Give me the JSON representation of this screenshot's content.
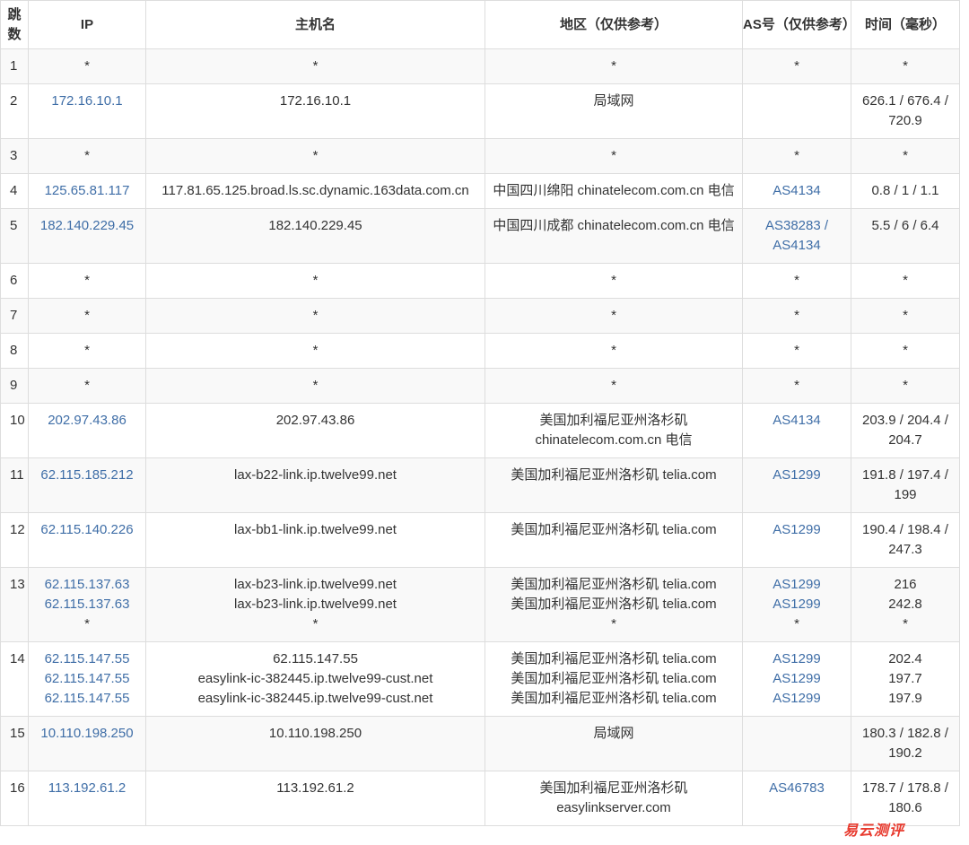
{
  "headers": {
    "hop": "跳数",
    "ip": "IP",
    "host": "主机名",
    "region": "地区（仅供参考）",
    "asn": "AS号（仅供参考）",
    "time": "时间（毫秒）"
  },
  "rows": [
    {
      "hop": "1",
      "ip": [
        "*"
      ],
      "host": [
        "*"
      ],
      "region": [
        "*"
      ],
      "asn": [
        "*"
      ],
      "time": [
        "*"
      ]
    },
    {
      "hop": "2",
      "ip": [
        "172.16.10.1"
      ],
      "host": [
        "172.16.10.1"
      ],
      "region": [
        "局域网"
      ],
      "asn": [],
      "time": [
        "626.1 / 676.4 / 720.9"
      ]
    },
    {
      "hop": "3",
      "ip": [
        "*"
      ],
      "host": [
        "*"
      ],
      "region": [
        "*"
      ],
      "asn": [
        "*"
      ],
      "time": [
        "*"
      ]
    },
    {
      "hop": "4",
      "ip": [
        "125.65.81.117"
      ],
      "host": [
        "117.81.65.125.broad.ls.sc.dynamic.163data.com.cn"
      ],
      "region": [
        "中国四川绵阳 chinatelecom.com.cn 电信"
      ],
      "asn": [
        "AS4134"
      ],
      "time": [
        "0.8 / 1 / 1.1"
      ]
    },
    {
      "hop": "5",
      "ip": [
        "182.140.229.45"
      ],
      "host": [
        "182.140.229.45"
      ],
      "region": [
        "中国四川成都 chinatelecom.com.cn 电信"
      ],
      "asn": [
        "AS38283 / AS4134"
      ],
      "time": [
        "5.5 / 6 / 6.4"
      ]
    },
    {
      "hop": "6",
      "ip": [
        "*"
      ],
      "host": [
        "*"
      ],
      "region": [
        "*"
      ],
      "asn": [
        "*"
      ],
      "time": [
        "*"
      ]
    },
    {
      "hop": "7",
      "ip": [
        "*"
      ],
      "host": [
        "*"
      ],
      "region": [
        "*"
      ],
      "asn": [
        "*"
      ],
      "time": [
        "*"
      ]
    },
    {
      "hop": "8",
      "ip": [
        "*"
      ],
      "host": [
        "*"
      ],
      "region": [
        "*"
      ],
      "asn": [
        "*"
      ],
      "time": [
        "*"
      ]
    },
    {
      "hop": "9",
      "ip": [
        "*"
      ],
      "host": [
        "*"
      ],
      "region": [
        "*"
      ],
      "asn": [
        "*"
      ],
      "time": [
        "*"
      ]
    },
    {
      "hop": "10",
      "ip": [
        "202.97.43.86"
      ],
      "host": [
        "202.97.43.86"
      ],
      "region": [
        "美国加利福尼亚州洛杉矶 chinatelecom.com.cn 电信"
      ],
      "asn": [
        "AS4134"
      ],
      "time": [
        "203.9 / 204.4 / 204.7"
      ]
    },
    {
      "hop": "11",
      "ip": [
        "62.115.185.212"
      ],
      "host": [
        "lax-b22-link.ip.twelve99.net"
      ],
      "region": [
        "美国加利福尼亚州洛杉矶 telia.com"
      ],
      "asn": [
        "AS1299"
      ],
      "time": [
        "191.8 / 197.4 / 199"
      ]
    },
    {
      "hop": "12",
      "ip": [
        "62.115.140.226"
      ],
      "host": [
        "lax-bb1-link.ip.twelve99.net"
      ],
      "region": [
        "美国加利福尼亚州洛杉矶 telia.com"
      ],
      "asn": [
        "AS1299"
      ],
      "time": [
        "190.4 / 198.4 / 247.3"
      ]
    },
    {
      "hop": "13",
      "ip": [
        "62.115.137.63",
        "62.115.137.63",
        "*"
      ],
      "host": [
        "lax-b23-link.ip.twelve99.net",
        "lax-b23-link.ip.twelve99.net",
        "*"
      ],
      "region": [
        "美国加利福尼亚州洛杉矶 telia.com",
        "美国加利福尼亚州洛杉矶 telia.com",
        "*"
      ],
      "asn": [
        "AS1299",
        "AS1299",
        "*"
      ],
      "time": [
        "216",
        "242.8",
        "*"
      ]
    },
    {
      "hop": "14",
      "ip": [
        "62.115.147.55",
        "62.115.147.55",
        "62.115.147.55"
      ],
      "host": [
        "62.115.147.55",
        "easylink-ic-382445.ip.twelve99-cust.net",
        "easylink-ic-382445.ip.twelve99-cust.net"
      ],
      "region": [
        "美国加利福尼亚州洛杉矶 telia.com",
        "美国加利福尼亚州洛杉矶 telia.com",
        "美国加利福尼亚州洛杉矶 telia.com"
      ],
      "asn": [
        "AS1299",
        "AS1299",
        "AS1299"
      ],
      "time": [
        "202.4",
        "197.7",
        "197.9"
      ]
    },
    {
      "hop": "15",
      "ip": [
        "10.110.198.250"
      ],
      "host": [
        "10.110.198.250"
      ],
      "region": [
        "局域网"
      ],
      "asn": [],
      "time": [
        "180.3 / 182.8 / 190.2"
      ]
    },
    {
      "hop": "16",
      "ip": [
        "113.192.61.2"
      ],
      "host": [
        "113.192.61.2"
      ],
      "region": [
        "美国加利福尼亚州洛杉矶 easylinkserver.com"
      ],
      "asn": [
        "AS46783"
      ],
      "time": [
        "178.7 / 178.8 / 180.6"
      ]
    }
  ],
  "watermark": "易云测评",
  "colors": {
    "link": "#3f6ea7",
    "border": "#dddddd",
    "stripe": "#f9f9f9",
    "watermark": "#e83a2e"
  }
}
